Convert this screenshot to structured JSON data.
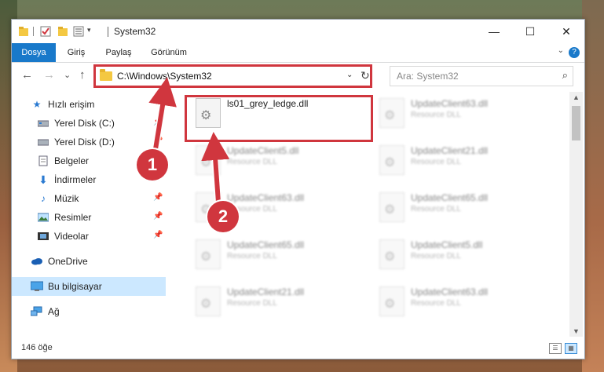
{
  "window": {
    "title": "System32",
    "controls": {
      "minimize": "—",
      "maximize": "☐",
      "close": "✕"
    }
  },
  "ribbon": {
    "tabs": [
      {
        "label": "Dosya",
        "active": true
      },
      {
        "label": "Giriş"
      },
      {
        "label": "Paylaş"
      },
      {
        "label": "Görünüm"
      }
    ],
    "help": "?"
  },
  "nav": {
    "back": "←",
    "forward": "→",
    "recent": "⌄",
    "up": "↑",
    "address": "C:\\Windows\\System32",
    "search_placeholder": "Ara: System32"
  },
  "sidebar": {
    "items": [
      {
        "label": "Hızlı erişim",
        "icon": "star-icon"
      },
      {
        "label": "Yerel Disk (C:)",
        "icon": "drive-icon"
      },
      {
        "label": "Yerel Disk (D:)",
        "icon": "drive-icon"
      },
      {
        "label": "Belgeler",
        "icon": "document-icon"
      },
      {
        "label": "İndirmeler",
        "icon": "download-icon"
      },
      {
        "label": "Müzik",
        "icon": "music-icon"
      },
      {
        "label": "Resimler",
        "icon": "pictures-icon"
      },
      {
        "label": "Videolar",
        "icon": "video-icon"
      },
      {
        "label": "OneDrive",
        "icon": "cloud-icon"
      },
      {
        "label": "Bu bilgisayar",
        "icon": "computer-icon",
        "selected": true
      },
      {
        "label": "Ağ",
        "icon": "network-icon"
      }
    ]
  },
  "files": [
    {
      "name": "ls01_grey_ledge.dll",
      "type": ""
    },
    {
      "name": "UpdateClient63.dll",
      "type": "Resource DLL"
    },
    {
      "name": "UpdateClient5.dll",
      "type": "Resource DLL"
    },
    {
      "name": "UpdateClient21.dll",
      "type": "Resource DLL"
    },
    {
      "name": "UpdateClient63.dll",
      "type": "Resource DLL"
    },
    {
      "name": "UpdateClient65.dll",
      "type": "Resource DLL"
    },
    {
      "name": "UpdateClient65.dll",
      "type": "Resource DLL"
    },
    {
      "name": "UpdateClient5.dll",
      "type": "Resource DLL"
    },
    {
      "name": "UpdateClient21.dll",
      "type": "Resource DLL"
    },
    {
      "name": "UpdateClient63.dll",
      "type": "Resource DLL"
    }
  ],
  "status": {
    "count": "146 öğe"
  },
  "annotations": {
    "step1": "1",
    "step2": "2",
    "color": "#d0363e"
  }
}
